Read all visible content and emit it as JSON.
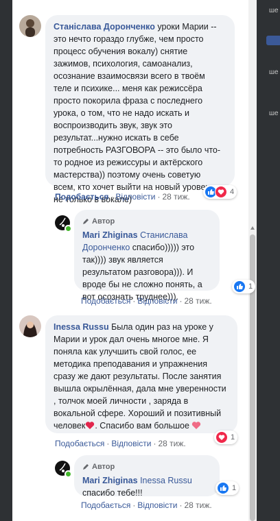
{
  "colors": {
    "link": "#385898",
    "bubble": "#f0f2f5",
    "like": "#1877f2",
    "love": "#f0284a"
  },
  "comments": [
    {
      "author": "Станіслава Доронченко",
      "text": "уроки Марии -- это нечто гораздо глубже, чем просто процесс обучения вокалу) снятие зажимов, психология, самоанализ, осознание взаимосвязи всего в твоём теле и психике... меня как режиссёра просто покорила фраза с последнего урока, о том, что не надо искать и воспроизводить звук, звук это результат...нужно искать в себе потребность РАЗГОВОРА -- это было что-то родное из режиссуры и актёрского мастерства)) поэтому очень советую всем, кто хочет выйти на новый уровень не только в вокале)",
      "lines": [
        "уроки Марии --",
        "это нечто гораздо глубже, чем просто",
        "процесс обучения вокалу) снятие",
        "зажимов, психология, самоанализ,",
        "осознание взаимосвязи всего в твоём",
        "теле и психике... меня как режиссёра",
        "просто покорила фраза с последнего",
        "урока, о том, что не надо искать и",
        "воспроизводить звук, звук это",
        "результат...нужно искать в себе",
        "потребность РАЗГОВОРА -- это было что-",
        "то родное из режиссуры и актёрского",
        "мастерства)) поэтому очень советую",
        "всем, кто хочет выйти на новый уровень",
        "не только в вокале)"
      ],
      "reaction_count": "4",
      "like_label": "Подобається",
      "reply_label": "Відповісти",
      "time": "28 тиж."
    },
    {
      "author_tag": "Автор",
      "author": "Mari Zhiginas",
      "mention": "Станислава Доронченко",
      "lines_after_mention": "спасибо))))) это так)))) звук является результатом разговора))). И вроде бы не сложно понять, а вот осознать труднее))).",
      "reaction_count": "1",
      "like_label": "Подобається",
      "reply_label": "Відповісти",
      "time": "28 тиж."
    },
    {
      "author": "Inessa Russu",
      "text_before_heart": "Была один раз на уроке у Марии и урок дал очень многое мне. Я поняла как улучшить свой голос, ее методика преподавания и упражнения сразу же дают результаты. После занятия вышла окрылённая, дала мне уверенности , толчок моей личности , заряда в вокальной сфере. Хороший и позитивный человек",
      "text_after_heart": ". Спасибо вам большое",
      "reaction_count": "1",
      "like_label": "Подобається",
      "reply_label": "Відповісти",
      "time": "28 тиж."
    },
    {
      "author_tag": "Автор",
      "author": "Mari Zhiginas",
      "mention": "Inessa Russu",
      "text": "спасибо тебе!!!",
      "reaction_count": "1",
      "like_label": "Подобається",
      "reply_label": "Відповісти",
      "time": "28 тиж."
    }
  ],
  "right_edge": {
    "label": "ше"
  },
  "icons": [
    "pen-icon",
    "like-reaction-icon",
    "love-reaction-icon",
    "heart-emoji-icon"
  ]
}
